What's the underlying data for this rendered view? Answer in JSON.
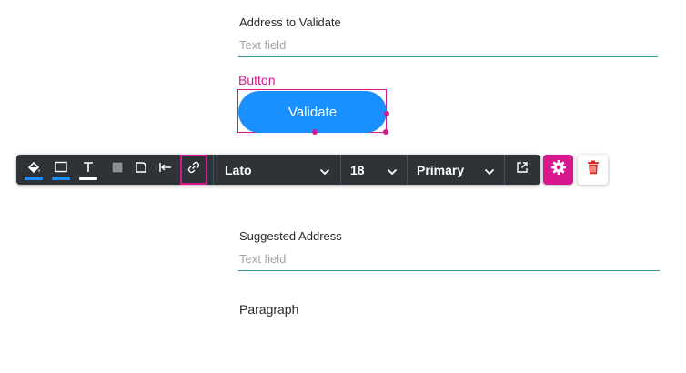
{
  "form": {
    "address_label": "Address to Validate",
    "address_placeholder": "Text field",
    "suggested_label": "Suggested Address",
    "suggested_placeholder": "Text field",
    "paragraph_text": "Paragraph"
  },
  "selection": {
    "element_type": "Button",
    "button_label": "Validate"
  },
  "toolbar": {
    "font_family": "Lato",
    "font_size": "18",
    "style_variant": "Primary",
    "fill_color": "#1a8fff",
    "border_color": "#1a8fff",
    "text_color": "#ffffff"
  },
  "colors": {
    "accent": "#d6178d",
    "button": "#1a8fff",
    "field_underline": "#2f9b9b",
    "delete": "#e02424"
  }
}
